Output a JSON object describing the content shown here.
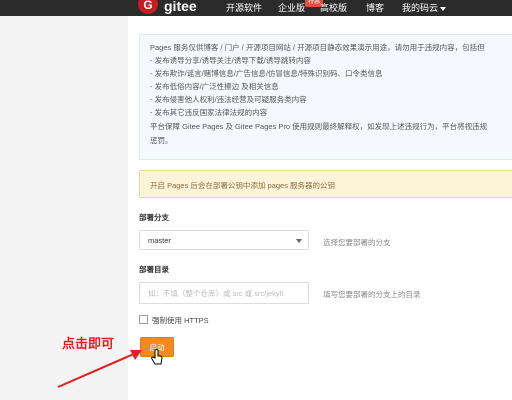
{
  "nav": {
    "logo_mark": "G",
    "logo_text": "gitee",
    "items": [
      "开源软件",
      "企业版",
      "高校版",
      "博客",
      "我的码云"
    ],
    "badge": "特惠"
  },
  "notice": {
    "lines": [
      "Pages 服务仅供博客 / 门户 / 开源项目网站 / 开源项目静态效果演示用途，请勿用于违规内容，包括但",
      "- 发布诱导分享/诱导关注/诱导下载/诱导跳转内容",
      "- 发布欺诈/谣言/赌博信息/广告信息/仿冒信息/特殊识别码、口令类信息",
      "- 发布低俗内容/广泛性擦边 及相关信息",
      "- 发布侵害他人权利/违法经营及可疑服务类内容",
      "- 发布其它违反国家法律法规的内容",
      "平台保障 Gitee Pages 及 Gitee Pages Pro 使用规则最终解释权，如发现上述违规行为，平台将视违规",
      "惩罚。"
    ]
  },
  "warning": "开启 Pages 后会在部署公钥中添加 pages 服务器的公钥",
  "form": {
    "branch_label": "部署分支",
    "branch_value": "master",
    "branch_hint": "选择您要部署的分支",
    "dir_label": "部署目录",
    "dir_placeholder": "如：不填（整个仓库）或 src 或 src/jekyll",
    "dir_hint": "填写您要部署的分支上的目录",
    "https_label": "强制使用 HTTPS",
    "start_button": "启动"
  },
  "annotation": {
    "text": "点击即可",
    "color": "#e51c23"
  }
}
